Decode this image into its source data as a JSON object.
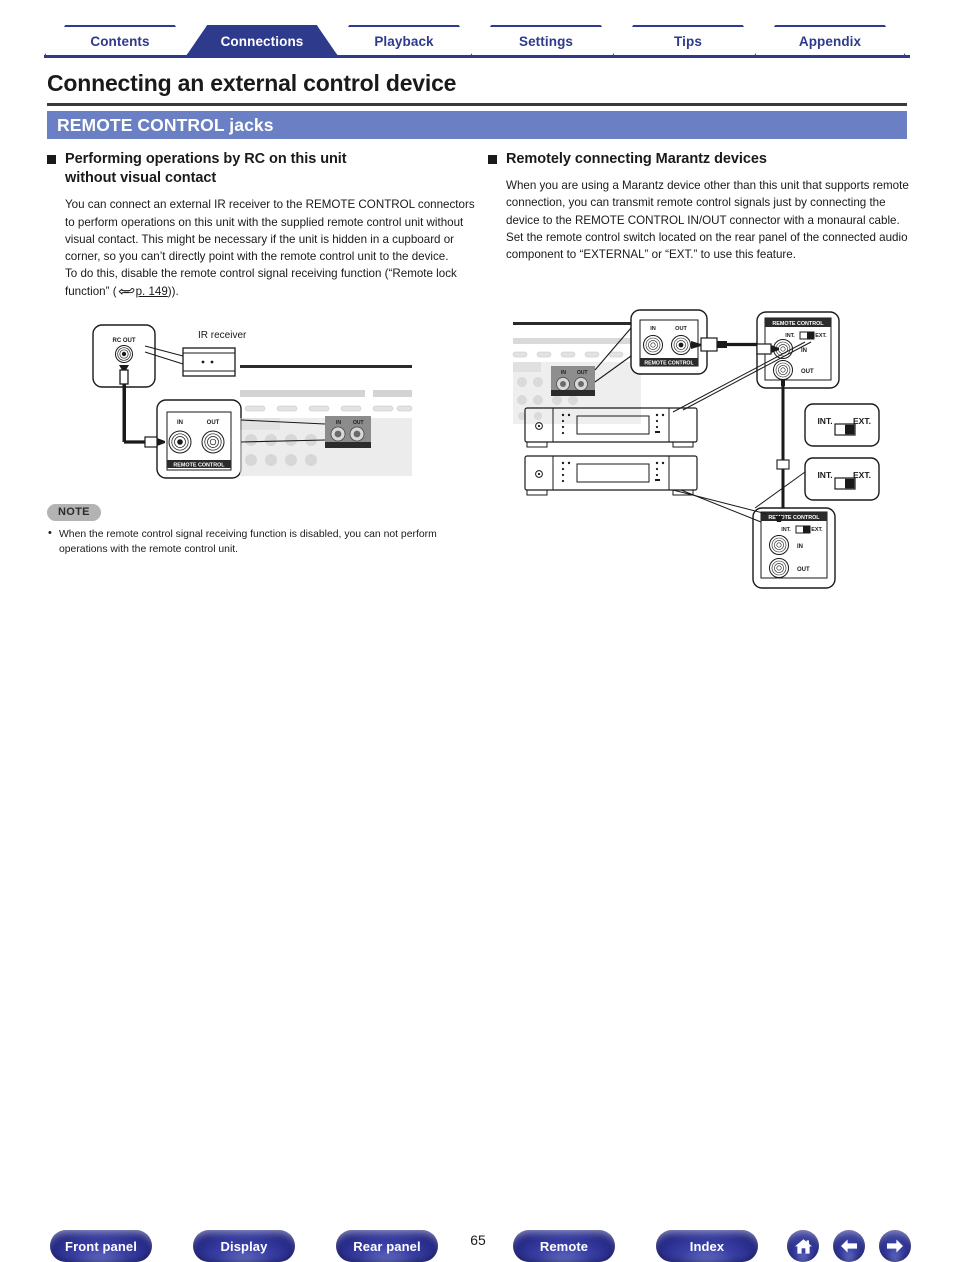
{
  "tabs": [
    {
      "label": "Contents",
      "active": false
    },
    {
      "label": "Connections",
      "active": true
    },
    {
      "label": "Playback",
      "active": false
    },
    {
      "label": "Settings",
      "active": false
    },
    {
      "label": "Tips",
      "active": false
    },
    {
      "label": "Appendix",
      "active": false
    }
  ],
  "page": {
    "title": "Connecting an external control device",
    "section_header": "REMOTE CONTROL jacks",
    "number": "65"
  },
  "left_column": {
    "heading_line1": "Performing operations by RC on this unit",
    "heading_line2": "without visual contact",
    "paragraph1": "You can connect an external IR receiver to the REMOTE CONTROL connectors to perform operations on this unit with the supplied remote control unit without visual contact. This might be necessary if the unit is hidden in a cupboard or corner, so you can’t directly point with the remote control unit to the device.",
    "paragraph2_pre": "To do this, disable the remote control signal receiving function (“Remote lock function” (",
    "paragraph2_link": "p. 149",
    "paragraph2_post": ")).",
    "diagram": {
      "ir_receiver_label": "IR receiver",
      "rc_out_label": "RC OUT",
      "jack_in_label": "IN",
      "jack_out_label": "OUT",
      "jack_panel_label": "REMOTE CONTROL"
    }
  },
  "note": {
    "badge": "NOTE",
    "text": "When the remote control signal receiving function is disabled, you can not perform operations with the remote control unit."
  },
  "right_column": {
    "heading": "Remotely connecting Marantz devices",
    "paragraph1": "When you are using a Marantz device other than this unit that supports remote connection, you can transmit remote control signals just by connecting the device to the REMOTE CONTROL IN/OUT connector with a monaural cable.",
    "paragraph2": "Set the remote control switch located on the rear panel of the connected audio component to “EXTERNAL” or “EXT.” to use this feature.",
    "diagram": {
      "unit_panel_label": "REMOTE CONTROL",
      "unit_in_label": "IN",
      "unit_out_label": "OUT",
      "device_panel_label": "REMOTE CONTROL",
      "device_in_label": "IN",
      "device_out_label": "OUT",
      "switch_int_label": "INT.",
      "switch_ext_label": "EXT."
    }
  },
  "bottom_nav": {
    "buttons": [
      {
        "label": "Front panel"
      },
      {
        "label": "Display"
      },
      {
        "label": "Rear panel"
      },
      {
        "label": "Remote"
      },
      {
        "label": "Index"
      }
    ],
    "icons": [
      {
        "name": "home-icon"
      },
      {
        "name": "arrow-left-icon"
      },
      {
        "name": "arrow-right-icon"
      }
    ]
  },
  "colors": {
    "tab_active": "#2e3a8c",
    "section_bar": "#6b80c4",
    "button_blue": "#2e3a8c",
    "note_badge": "#b3b3b3"
  }
}
